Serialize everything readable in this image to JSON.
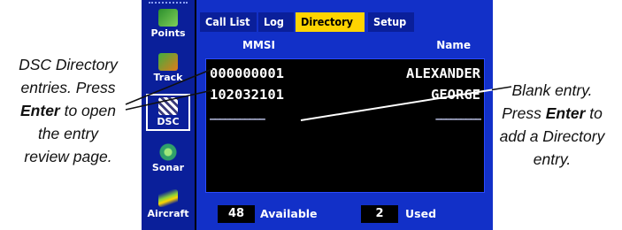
{
  "callouts": {
    "left": {
      "line1": "DSC Directory",
      "line2": "entries. Press",
      "bold": "Enter",
      "line3_rest": " to open",
      "line4": "the entry",
      "line5": "review page."
    },
    "right": {
      "line1": "Blank entry.",
      "line2_pre": "Press ",
      "bold": "Enter",
      "line2_post": " to",
      "line3": "add a Directory",
      "line4": "entry."
    }
  },
  "sidebar": {
    "items": [
      {
        "label": "Points",
        "icon": "points-icon",
        "color": "#3fae3f"
      },
      {
        "label": "Track",
        "icon": "track-icon",
        "color": "#e07a1a"
      },
      {
        "label": "DSC",
        "icon": "dsc-icon",
        "color": "#7a7a9a"
      },
      {
        "label": "Sonar",
        "icon": "sonar-icon",
        "color": "#2fa06a"
      },
      {
        "label": "Aircraft",
        "icon": "aircraft-icon",
        "color": "#8bd13a"
      }
    ],
    "active": "DSC"
  },
  "tabs": [
    {
      "label": "Call List"
    },
    {
      "label": "Log"
    },
    {
      "label": "Directory",
      "active": true
    },
    {
      "label": "Setup"
    }
  ],
  "columns": {
    "mmsi": "MMSI",
    "name": "Name"
  },
  "entries": [
    {
      "mmsi": "000000001",
      "name": "ALEXANDER"
    },
    {
      "mmsi": "102032101",
      "name": "GEORGE"
    },
    {
      "mmsi": "———————————",
      "name": "—————————"
    }
  ],
  "footer": {
    "available_count": "48",
    "available_label": "Available",
    "used_count": "2",
    "used_label": "Used"
  },
  "colors": {
    "screen_blue": "#1230c8",
    "sidebar_blue": "#0a1f9a",
    "active_tab": "#ffd400"
  }
}
